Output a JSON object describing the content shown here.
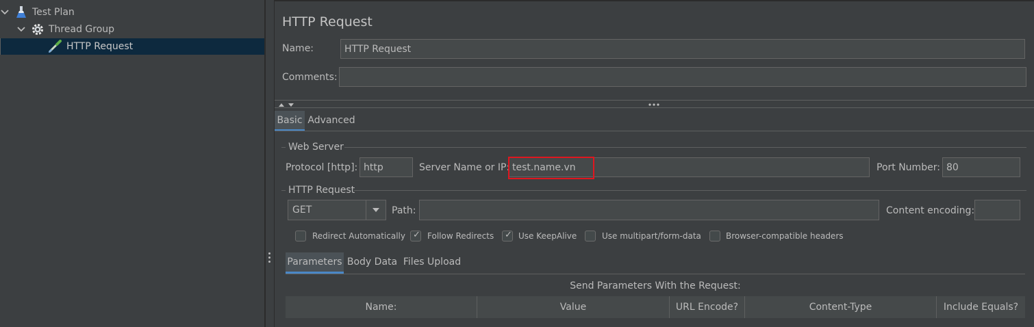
{
  "tree": {
    "items": [
      {
        "label": "Test Plan"
      },
      {
        "label": "Thread Group"
      },
      {
        "label": "HTTP Request"
      }
    ]
  },
  "panel": {
    "title": "HTTP Request",
    "name_label": "Name:",
    "name_value": "HTTP Request",
    "comments_label": "Comments:",
    "comments_value": ""
  },
  "tabs": {
    "top": [
      {
        "label": "Basic"
      },
      {
        "label": "Advanced"
      }
    ],
    "bottom": [
      {
        "label": "Parameters"
      },
      {
        "label": "Body Data"
      },
      {
        "label": "Files Upload"
      }
    ]
  },
  "web_server": {
    "legend": "Web Server",
    "protocol_label": "Protocol [http]:",
    "protocol_value": "http",
    "server_label": "Server Name or IP:",
    "server_value": "test.name.vn",
    "port_label": "Port Number:",
    "port_value": "80"
  },
  "http_request": {
    "legend": "HTTP Request",
    "method_value": "GET",
    "path_label": "Path:",
    "path_value": "",
    "encoding_label": "Content encoding:",
    "encoding_value": ""
  },
  "options": [
    {
      "label": "Redirect Automatically",
      "checked": false
    },
    {
      "label": "Follow Redirects",
      "checked": true
    },
    {
      "label": "Use KeepAlive",
      "checked": true
    },
    {
      "label": "Use multipart/form-data",
      "checked": false
    },
    {
      "label": "Browser-compatible headers",
      "checked": false
    }
  ],
  "params": {
    "caption": "Send Parameters With the Request:",
    "columns": [
      "Name:",
      "Value",
      "URL Encode?",
      "Content-Type",
      "Include Equals?"
    ]
  },
  "colors": {
    "highlight_box": "#e0161f",
    "accent": "#4a88c7",
    "selected_row": "#0d293e"
  }
}
